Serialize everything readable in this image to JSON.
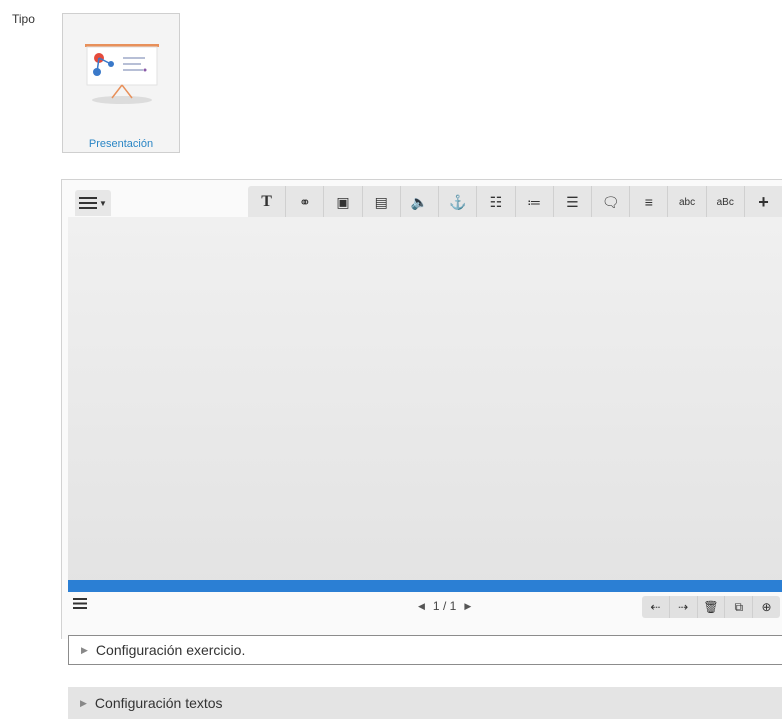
{
  "tipo": {
    "label": "Tipo"
  },
  "type_card": {
    "label": "Presentación",
    "icon": "presentation-board-icon"
  },
  "editor": {
    "menu_icon": "hamburger-menu-icon",
    "toolbar": [
      {
        "name": "text-icon",
        "glyph": "T"
      },
      {
        "name": "link-icon",
        "glyph": "⚭"
      },
      {
        "name": "image-icon",
        "glyph": "▣"
      },
      {
        "name": "video-icon",
        "glyph": "▤"
      },
      {
        "name": "audio-icon",
        "glyph": "🔈"
      },
      {
        "name": "anchor-icon",
        "glyph": "⚓"
      },
      {
        "name": "sliders-icon",
        "glyph": "☷"
      },
      {
        "name": "ordered-list-icon",
        "glyph": "≔"
      },
      {
        "name": "bullet-list-icon",
        "glyph": "☰"
      },
      {
        "name": "comment-icon",
        "glyph": "🗨"
      },
      {
        "name": "list-icon",
        "glyph": "≡"
      },
      {
        "name": "text-field-icon",
        "glyph": "abc"
      },
      {
        "name": "fill-blank-icon",
        "glyph": "aBc"
      },
      {
        "name": "add-icon",
        "glyph": "+"
      }
    ],
    "pager": {
      "current": "1",
      "separator": "/",
      "total": "1"
    },
    "slide_tools": [
      {
        "name": "insert-before-icon",
        "glyph": "⇠"
      },
      {
        "name": "insert-after-icon",
        "glyph": "⇢"
      },
      {
        "name": "delete-icon",
        "glyph": "🗑"
      },
      {
        "name": "duplicate-icon",
        "glyph": "⧉"
      },
      {
        "name": "add-circle-icon",
        "glyph": "⊕"
      }
    ],
    "progress_color": "#2b7fd4"
  },
  "sections": [
    {
      "label": "Configuración exercicio."
    },
    {
      "label": "Configuración textos"
    }
  ]
}
